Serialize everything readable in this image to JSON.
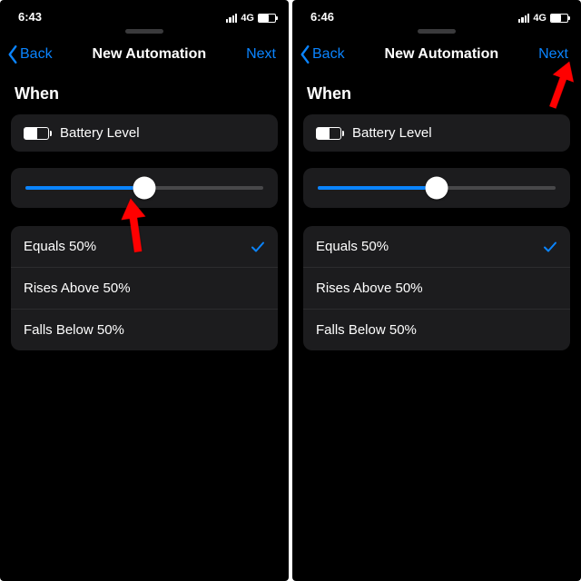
{
  "left": {
    "status_time": "6:43",
    "status_network": "4G",
    "nav_back": "Back",
    "nav_title": "New Automation",
    "nav_next": "Next",
    "when_label": "When",
    "trigger_label": "Battery Level",
    "slider_percent": 50,
    "options": [
      {
        "label": "Equals 50%",
        "selected": true
      },
      {
        "label": "Rises Above 50%",
        "selected": false
      },
      {
        "label": "Falls Below 50%",
        "selected": false
      }
    ]
  },
  "right": {
    "status_time": "6:46",
    "status_network": "4G",
    "nav_back": "Back",
    "nav_title": "New Automation",
    "nav_next": "Next",
    "when_label": "When",
    "trigger_label": "Battery Level",
    "slider_percent": 50,
    "options": [
      {
        "label": "Equals 50%",
        "selected": true
      },
      {
        "label": "Rises Above 50%",
        "selected": false
      },
      {
        "label": "Falls Below 50%",
        "selected": false
      }
    ]
  },
  "accent_color": "#0a84ff",
  "arrow_color": "#ff0000"
}
